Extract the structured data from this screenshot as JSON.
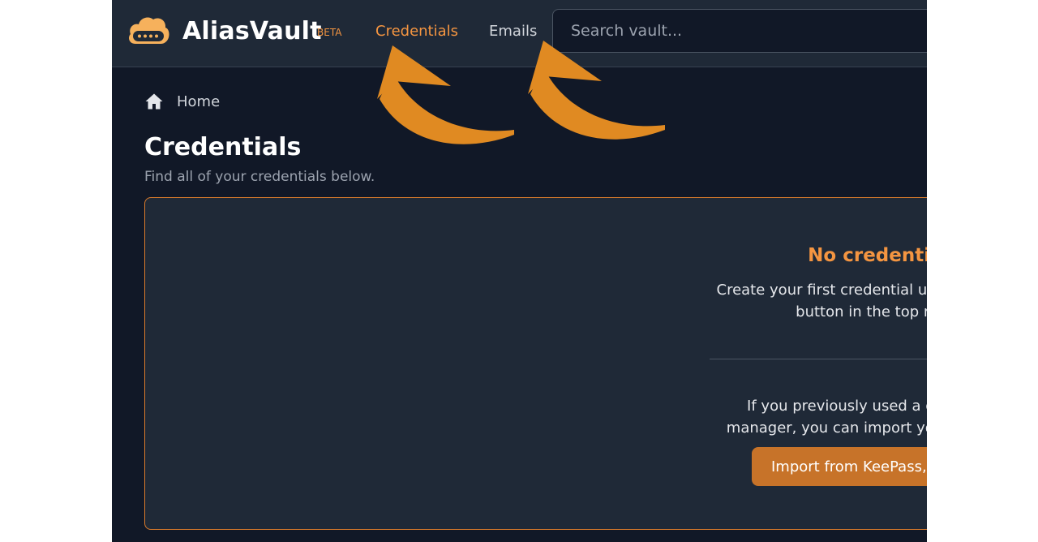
{
  "header": {
    "brand": "AliasVault",
    "beta_badge": "BETA",
    "nav": [
      {
        "label": "Credentials",
        "active": true
      },
      {
        "label": "Emails",
        "active": false
      }
    ],
    "search": {
      "placeholder": "Search vault...",
      "value": ""
    }
  },
  "breadcrumb": {
    "home_label": "Home"
  },
  "page": {
    "title": "Credentials",
    "subtitle": "Find all of your credentials below."
  },
  "empty_state": {
    "title": "No credentials yet",
    "description": "Create your first credential using the \"+ New Alias\" button in the top right corner.",
    "import_text": "If you previously used a different password manager, you can import your passwords below.",
    "import_button": "Import from KeePass, Bitwarden etc."
  },
  "colors": {
    "accent": "#f49541",
    "background": "#111827",
    "surface": "#1f2937",
    "annotation_arrow": "#e08a22"
  },
  "icons": [
    "cloud-logo-icon",
    "home-icon",
    "arrow-annotation-icon"
  ]
}
